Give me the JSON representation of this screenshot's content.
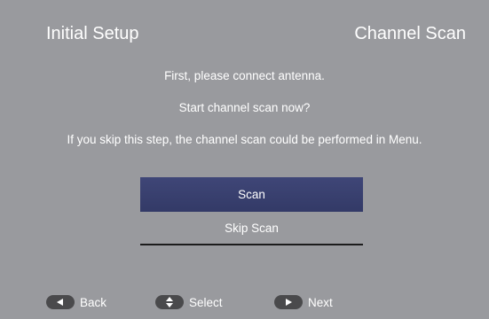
{
  "header": {
    "title_left": "Initial Setup",
    "title_right": "Channel Scan"
  },
  "messages": {
    "line1": "First, please connect antenna.",
    "line2": "Start channel scan now?",
    "line3": "If you skip this step, the channel scan could be performed in Menu."
  },
  "options": {
    "scan": "Scan",
    "skip": "Skip Scan",
    "selected": "Scan"
  },
  "legend": {
    "back": "Back",
    "select": "Select",
    "next": "Next",
    "back_icon": "left-arrow-key-icon",
    "select_icon": "up-down-arrow-key-icon",
    "next_icon": "right-arrow-key-icon"
  },
  "colors": {
    "background": "#999a9e",
    "highlight": "#363d6b",
    "text": "#ffffff",
    "key": "#4a4a4c"
  }
}
